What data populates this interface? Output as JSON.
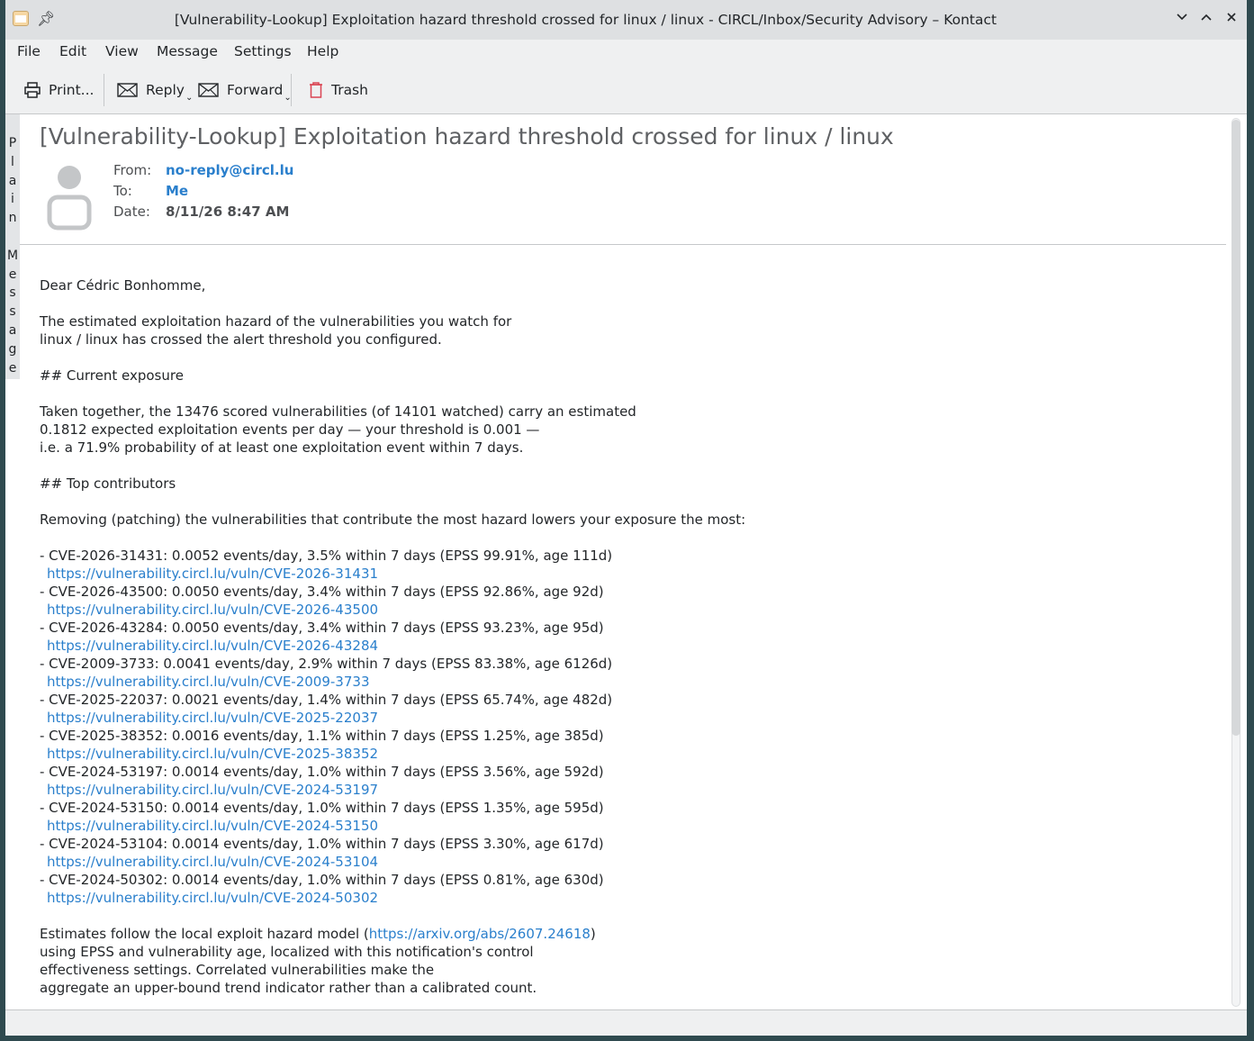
{
  "window": {
    "title": "[Vulnerability-Lookup] Exploitation hazard threshold crossed for linux / linux - CIRCL/Inbox/Security Advisory – Kontact"
  },
  "menu": [
    "File",
    "Edit",
    "View",
    "Message",
    "Settings",
    "Help"
  ],
  "toolbar": {
    "print": "Print...",
    "reply": "Reply",
    "forward": "Forward",
    "trash": "Trash"
  },
  "side_label": "Plain Message",
  "message": {
    "subject": "[Vulnerability-Lookup] Exploitation hazard threshold crossed for linux / linux",
    "from_label": "From:",
    "from": "no-reply@circl.lu",
    "to_label": "To:",
    "to": "Me",
    "date_label": "Date:",
    "date": "8/11/26 8:47 AM",
    "greeting": "Dear Cédric Bonhomme,",
    "intro": [
      "The estimated exploitation hazard of the vulnerabilities you watch for",
      "linux / linux has crossed the alert threshold you configured."
    ],
    "exposure_heading": "## Current exposure",
    "exposure": [
      "Taken together, the 13476 scored vulnerabilities (of 14101 watched) carry an estimated",
      "0.1812 expected exploitation events per day — your threshold is 0.001 —",
      "i.e. a 71.9% probability of at least one exploitation event within 7 days."
    ],
    "contrib_heading": "## Top contributors",
    "contrib_intro": "Removing (patching) the vulnerabilities that contribute the most hazard lowers your exposure the most:",
    "contributors": [
      {
        "line": "- CVE-2026-31431: 0.0052 events/day, 3.5% within 7 days (EPSS 99.91%, age 111d)",
        "url": "https://vulnerability.circl.lu/vuln/CVE-2026-31431"
      },
      {
        "line": "- CVE-2026-43500: 0.0050 events/day, 3.4% within 7 days (EPSS 92.86%, age 92d)",
        "url": "https://vulnerability.circl.lu/vuln/CVE-2026-43500"
      },
      {
        "line": "- CVE-2026-43284: 0.0050 events/day, 3.4% within 7 days (EPSS 93.23%, age 95d)",
        "url": "https://vulnerability.circl.lu/vuln/CVE-2026-43284"
      },
      {
        "line": "- CVE-2009-3733: 0.0041 events/day, 2.9% within 7 days (EPSS 83.38%, age 6126d)",
        "url": "https://vulnerability.circl.lu/vuln/CVE-2009-3733"
      },
      {
        "line": "- CVE-2025-22037: 0.0021 events/day, 1.4% within 7 days (EPSS 65.74%, age 482d)",
        "url": "https://vulnerability.circl.lu/vuln/CVE-2025-22037"
      },
      {
        "line": "- CVE-2025-38352: 0.0016 events/day, 1.1% within 7 days (EPSS 1.25%, age 385d)",
        "url": "https://vulnerability.circl.lu/vuln/CVE-2025-38352"
      },
      {
        "line": "- CVE-2024-53197: 0.0014 events/day, 1.0% within 7 days (EPSS 3.56%, age 592d)",
        "url": "https://vulnerability.circl.lu/vuln/CVE-2024-53197"
      },
      {
        "line": "- CVE-2024-53150: 0.0014 events/day, 1.0% within 7 days (EPSS 1.35%, age 595d)",
        "url": "https://vulnerability.circl.lu/vuln/CVE-2024-53150"
      },
      {
        "line": "- CVE-2024-53104: 0.0014 events/day, 1.0% within 7 days (EPSS 3.30%, age 617d)",
        "url": "https://vulnerability.circl.lu/vuln/CVE-2024-53104"
      },
      {
        "line": "- CVE-2024-50302: 0.0014 events/day, 1.0% within 7 days (EPSS 0.81%, age 630d)",
        "url": "https://vulnerability.circl.lu/vuln/CVE-2024-50302"
      }
    ],
    "footer_pre": "Estimates follow the local exploit hazard model (",
    "footer_link": "https://arxiv.org/abs/2607.24618",
    "footer_post": ")",
    "footer_lines": [
      "using EPSS and vulnerability age, localized with this notification's control",
      "effectiveness settings. Correlated vulnerabilities make the",
      "aggregate an upper-bound trend indicator rather than a calibrated count."
    ]
  },
  "colors": {
    "link": "#2a7fcc",
    "trash_icon": "#da4453"
  }
}
